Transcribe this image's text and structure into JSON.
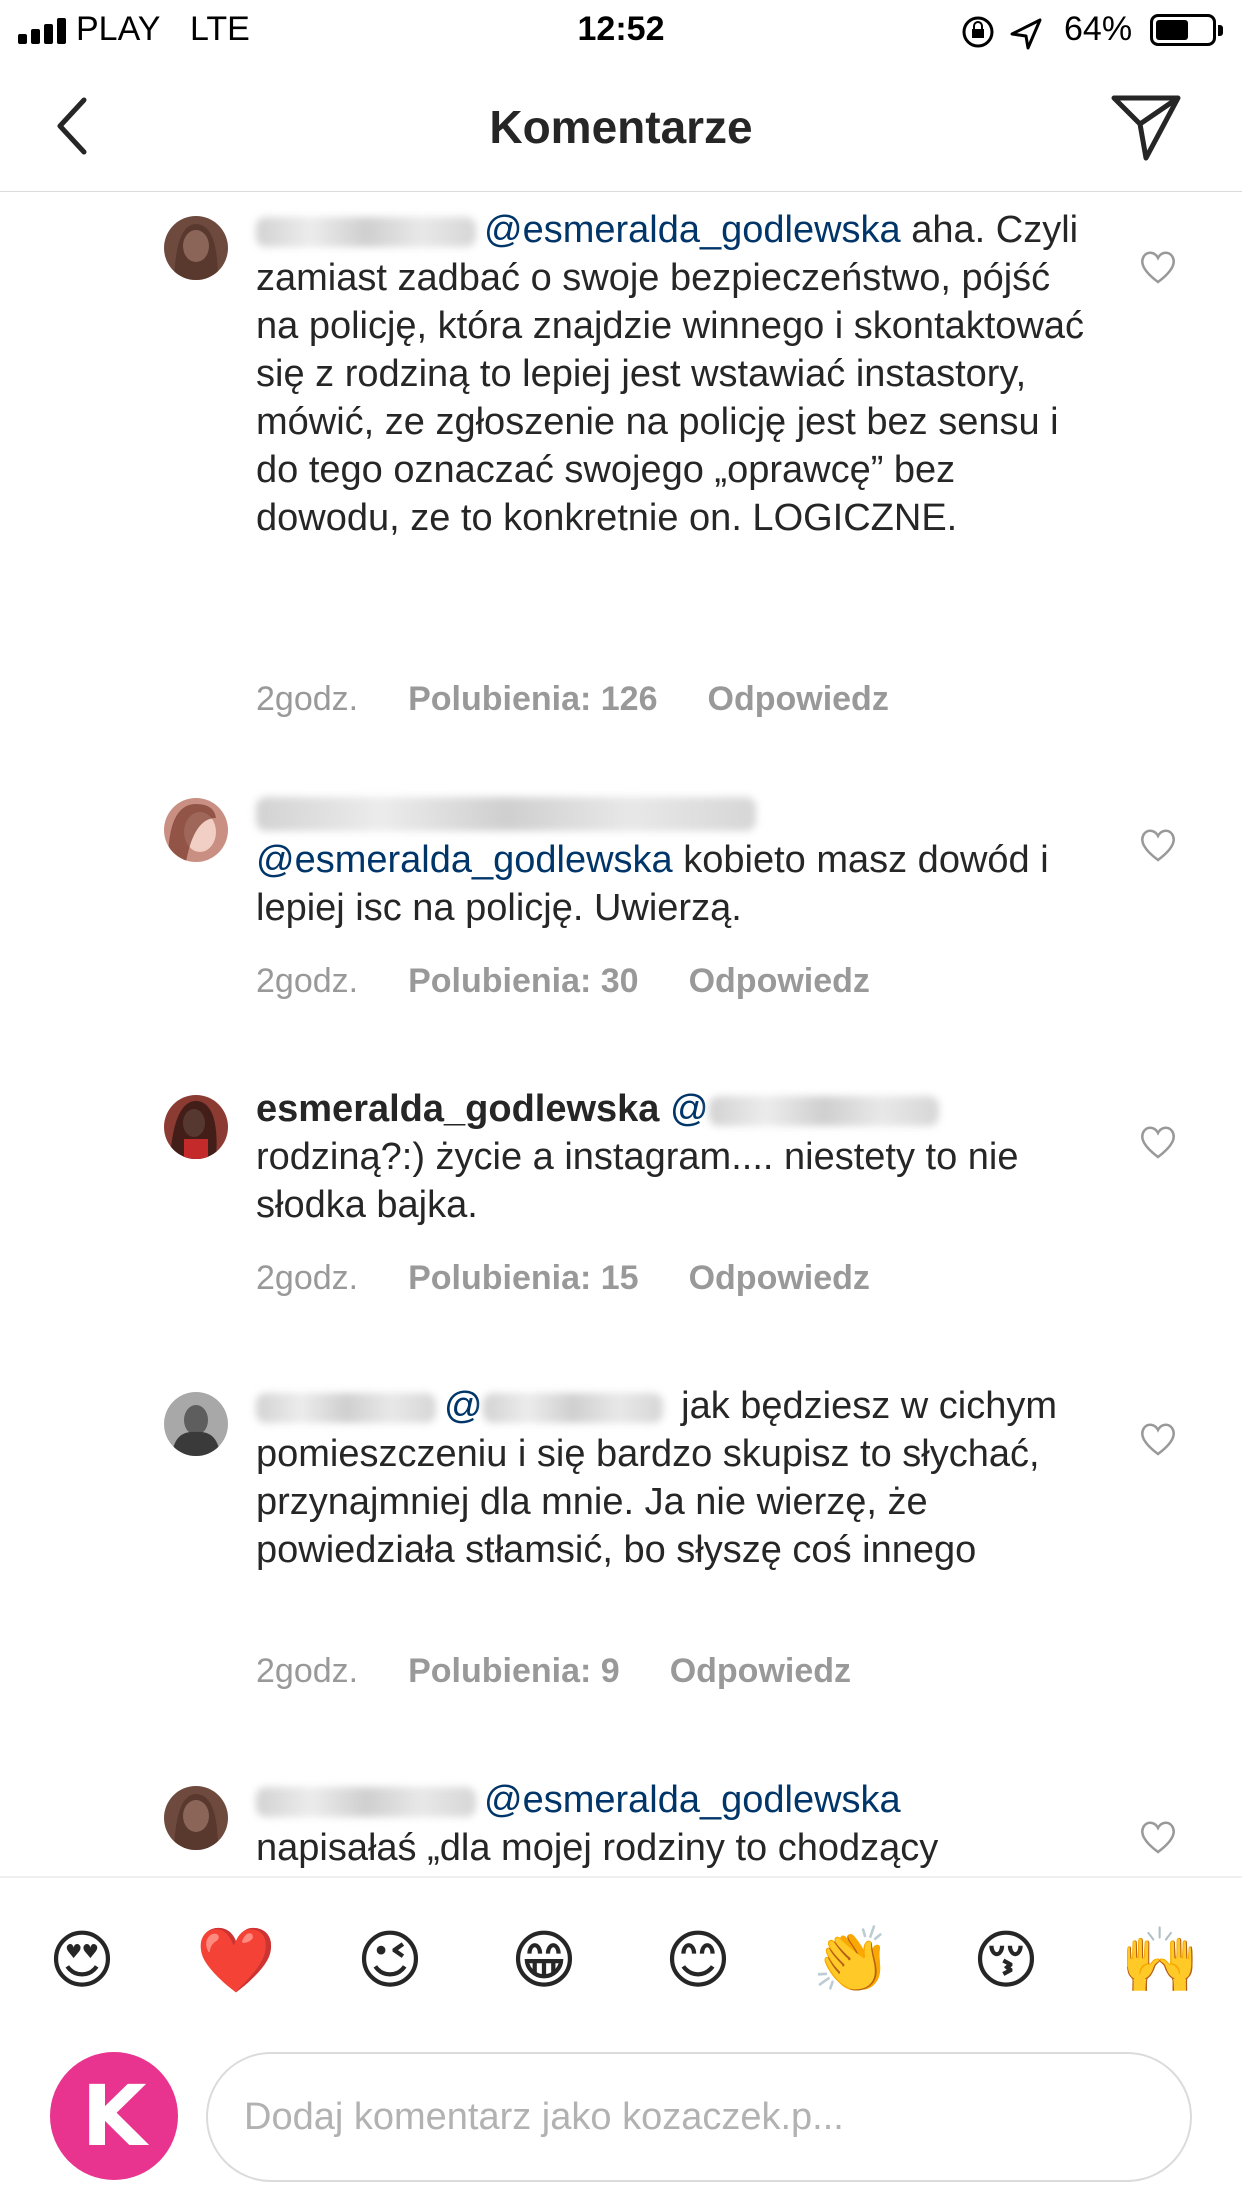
{
  "status_bar": {
    "carrier": "PLAY",
    "network": "LTE",
    "time": "12:52",
    "battery_percent": "64%",
    "battery_level": 0.64
  },
  "nav": {
    "title": "Komentarze",
    "back_icon": "chevron-left-icon",
    "send_icon": "paper-plane-icon"
  },
  "comments": [
    {
      "username": "",
      "mention": "@esmeralda_godlewska",
      "text": " aha. Czyli zamiast zadbać o swoje bezpieczeństwo, pójść na policję, która znajdzie winnego  i skontaktować się z rodziną to lepiej jest wstawiać instastory, mówić, ze zgłoszenie na policję jest bez sensu i do tego oznaczać swojego „oprawcę” bez dowodu, ze to konkretnie on. LOGICZNE.",
      "time": "2godz.",
      "likes": "Polubienia: 126",
      "reply": "Odpowiedz"
    },
    {
      "username": "",
      "mention": "@esmeralda_godlewska",
      "text": " kobieto masz dowód i lepiej isc na policję.  Uwierzą.",
      "time": "2godz.",
      "likes": "Polubienia: 30",
      "reply": "Odpowiedz"
    },
    {
      "username": "esmeralda_godlewska",
      "mention": "@",
      "text": "rodziną?:) życie a instagram.... niestety to nie słodka bajka.",
      "time": "2godz.",
      "likes": "Polubienia: 15",
      "reply": "Odpowiedz"
    },
    {
      "username": "",
      "mention": "@",
      "text": "  jak będziesz w cichym pomieszczeniu i się bardzo skupisz to słychać, przynajmniej dla mnie. Ja nie wierzę, że powiedziała stłamsić, bo słyszę coś innego",
      "time": "2godz.",
      "likes": "Polubienia: 9",
      "reply": "Odpowiedz"
    },
    {
      "username": "",
      "mention": "@esmeralda_godlewska",
      "text": "napisałaś „dla mojej rodziny to chodzący"
    }
  ],
  "emoji_row": [
    "😍",
    "❤️",
    "😉",
    "😁",
    "😊",
    "👏",
    "😚",
    "🙌"
  ],
  "composer": {
    "avatar_letter": "K",
    "placeholder": "Dodaj komentarz jako kozaczek.p..."
  }
}
